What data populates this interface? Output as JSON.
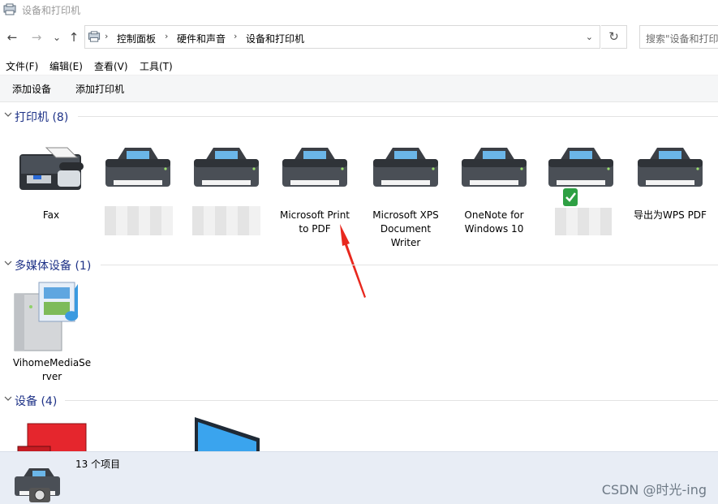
{
  "window": {
    "title": "设备和打印机"
  },
  "nav": {
    "back": "←",
    "forward": "→",
    "recent": "⌄",
    "up": "↑"
  },
  "address": {
    "crumbs": [
      "控制面板",
      "硬件和声音",
      "设备和打印机"
    ],
    "separator": "›",
    "dropdown": "⌄",
    "refresh": "↻"
  },
  "search": {
    "placeholder": "搜索\"设备和打印机\""
  },
  "menu": [
    "文件(F)",
    "编辑(E)",
    "查看(V)",
    "工具(T)"
  ],
  "commands": [
    "添加设备",
    "添加打印机"
  ],
  "sections": {
    "printers": {
      "label": "打印机 (8)",
      "items": [
        {
          "name": "Fax",
          "icon": "fax-icon"
        },
        {
          "name": "",
          "icon": "printer-icon",
          "blurred": true
        },
        {
          "name": "",
          "icon": "printer-icon",
          "blurred": true
        },
        {
          "name": "Microsoft Print to PDF",
          "icon": "printer-icon"
        },
        {
          "name": "Microsoft XPS Document Writer",
          "icon": "printer-icon"
        },
        {
          "name": "OneNote for Windows 10",
          "icon": "printer-icon"
        },
        {
          "name": "",
          "icon": "printer-icon",
          "blurred": true,
          "default": true
        },
        {
          "name": "导出为WPS PDF",
          "icon": "printer-icon"
        }
      ]
    },
    "multimedia": {
      "label": "多媒体设备 (1)",
      "items": [
        {
          "name": "VihomeMediaServer",
          "icon": "media-server-icon"
        }
      ]
    },
    "devices": {
      "label": "设备 (4)",
      "items": [
        {
          "name": "",
          "icon": "device-red-icon"
        },
        {
          "name": "",
          "icon": "monitor-icon"
        }
      ]
    }
  },
  "annotation": {
    "color": "#e8281e",
    "target": "Microsoft Print to PDF"
  },
  "status": {
    "count": "13 个项目"
  },
  "watermark": "CSDN @时光-ing",
  "colors": {
    "section_header": "#1e3287",
    "status_bg": "#e8edf5",
    "default_check": "#2ea043"
  }
}
